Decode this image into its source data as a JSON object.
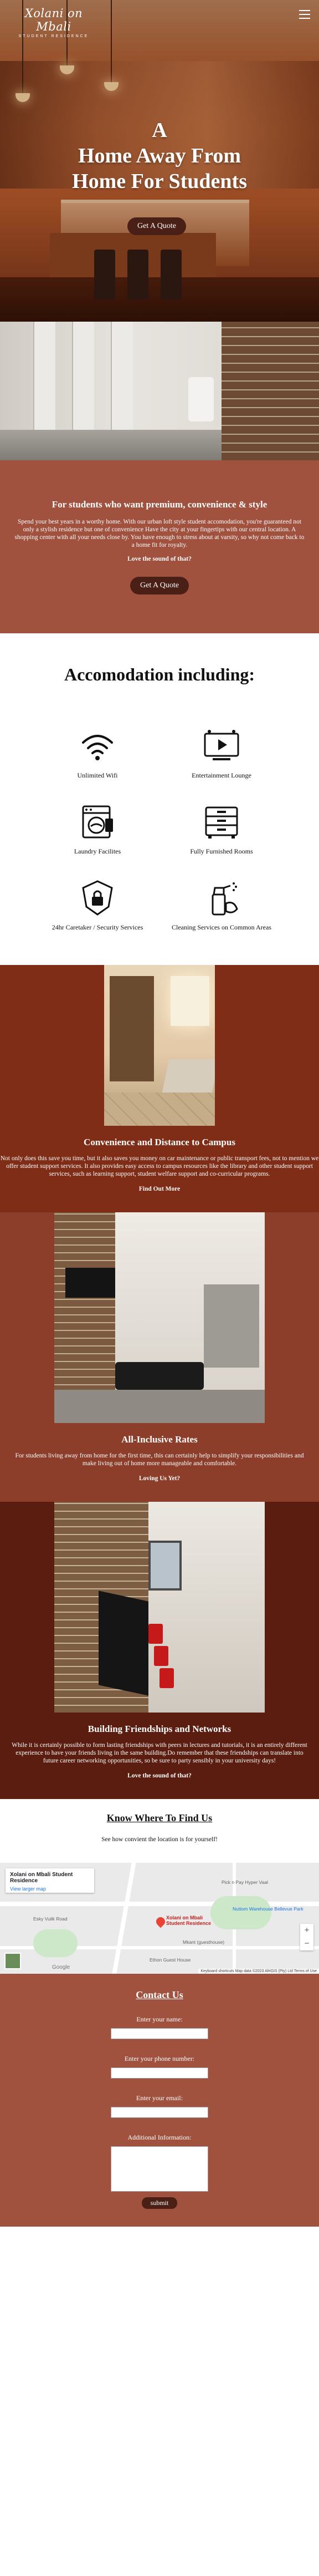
{
  "brand": {
    "script": "Xolani on Mbali",
    "sub": "STUDENT RESIDENCE"
  },
  "hero": {
    "title_line1": "A",
    "title_line2": "Home Away From",
    "title_line3": "Home For Students",
    "cta": "Get A Quote"
  },
  "intro": {
    "heading": "For students who want premium, convenience & style",
    "body": "Spend your best years in a worthy home. With our urban loft style student accomodation, you're guaranteed not only a stylish residence but one of convenience Have the city at your fingertips with our central location. A shopping center with all your needs close by. You have enough to stress about at varsity, so why not come back to a home fit for royalty.",
    "ask": "Love the sound of that?",
    "cta": "Get A Quote"
  },
  "amenities": {
    "heading": "Accomodation including:",
    "items": [
      {
        "label": "Unlimited Wifi",
        "icon": "wifi-icon"
      },
      {
        "label": "Entertainment Lounge",
        "icon": "entertainment-icon"
      },
      {
        "label": "Laundry Facilites",
        "icon": "laundry-icon"
      },
      {
        "label": "Fully Furnished Rooms",
        "icon": "furnished-room-icon"
      },
      {
        "label": "24hr Caretaker / Security Services",
        "icon": "security-lock-icon"
      },
      {
        "label": "Cleaning Services on Common Areas",
        "icon": "cleaning-spray-icon"
      }
    ]
  },
  "sections": [
    {
      "heading": "Convenience and Distance to Campus",
      "body": "Not only does this save you time, but it also saves you money on car maintenance or public transport fees, not to mention we offer student support services. It also provides easy access to campus resources like the library and other student support services, such as learning support, student welfare support and co-curricular programs.",
      "cta": "Find Out More"
    },
    {
      "heading": "All-Inclusive Rates",
      "body": "For students living away from home for the first time, this can certainly help to simplify your responsibilities and make living out of home more manageable and comfortable.",
      "cta": "Loving Us Yet?"
    },
    {
      "heading": "Building Friendships and Networks",
      "body": "While it is certainly possible to form lasting friendships with peers in lectures and tutorials, it is an entirely different experience to have your friends living in the same building.Do remember that these friendships can translate into future career networking opportunities, so be sure to party sensibly in your university days!",
      "cta": "Love the sound of that?"
    }
  ],
  "findus": {
    "heading": "Know Where To Find Us",
    "sub": "See how convient the location is for yourself!",
    "map": {
      "card_title": "Xolani on Mbali Student Residence",
      "card_link": "View larger map",
      "pin_label_1": "Xolani on Mbali",
      "pin_label_2": "Student Residence",
      "places": [
        "Pick n Pay Hyper Vaal",
        "Nuttom Warehouse Bellevue Park",
        "Esky Vuilk Road",
        "Mkant (guesthouse)",
        "Ethon Guest House"
      ],
      "google": "Google",
      "attribution": "Keyboard shortcuts  Map data ©2023 AfriGIS (Pty) Ltd  Terms of Use"
    }
  },
  "contact": {
    "heading": "Contact Us",
    "name_label": "Enter your name:",
    "phone_label": "Enter your phone number:",
    "email_label": "Enter your email:",
    "info_label": "Additional Information:",
    "submit": "submit"
  },
  "colors": {
    "section_rust": "#a0523f",
    "section_dark": "#7f2d16",
    "section_deep": "#5a1d0f",
    "button": "#4a2016"
  }
}
